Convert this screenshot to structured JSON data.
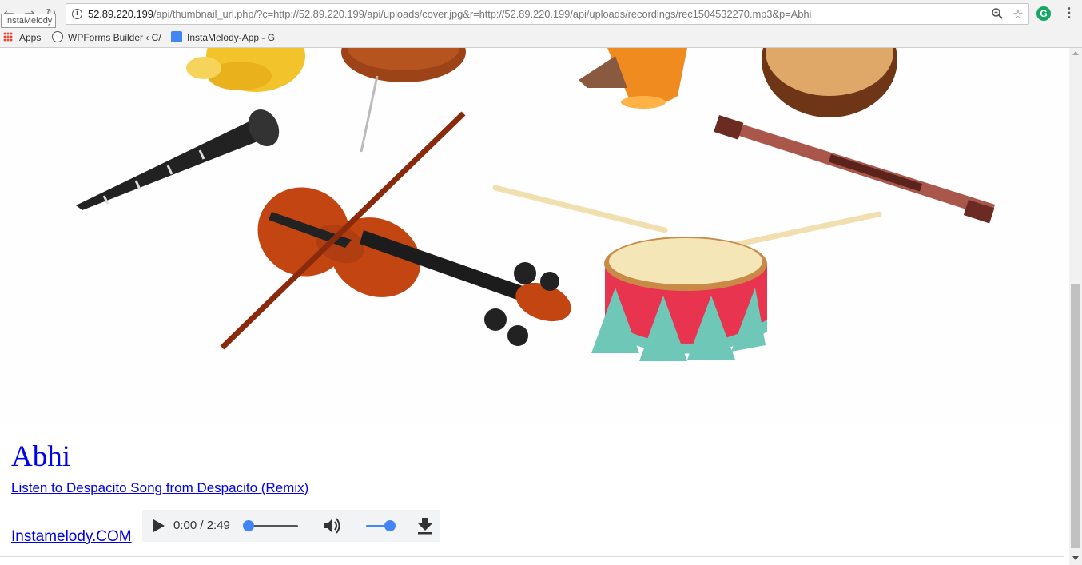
{
  "browser": {
    "tab_tooltip": "InstaMelody",
    "url_host": "52.89.220.199",
    "url_path": "/api/thumbnail_url.php/?c=http://52.89.220.199/api/uploads/cover.jpg&r=http://52.89.220.199/api/uploads/recordings/rec1504532270.mp3&p=Abhi",
    "extension_letter": "G",
    "bookmarks": [
      {
        "label": "Apps",
        "icon": "apps-grid-icon"
      },
      {
        "label": "WPForms Builder ‹ C/",
        "icon": "wordpress-icon"
      },
      {
        "label": "InstaMelody-App - G",
        "icon": "google-docs-icon"
      }
    ]
  },
  "page": {
    "title": "Abhi",
    "listen_link": "Listen to Despacito Song from Despacito (Remix)",
    "site_link": "Instamelody.COM "
  },
  "player": {
    "current_time": "0:00",
    "duration": "2:49",
    "time_display": "0:00 / 2:49",
    "progress_fraction": 0.0,
    "volume_fraction": 1.0
  },
  "colors": {
    "link": "#0000ee",
    "accent": "#4285f4",
    "drum_red": "#e8344e",
    "drum_teal": "#6fc7b8"
  }
}
